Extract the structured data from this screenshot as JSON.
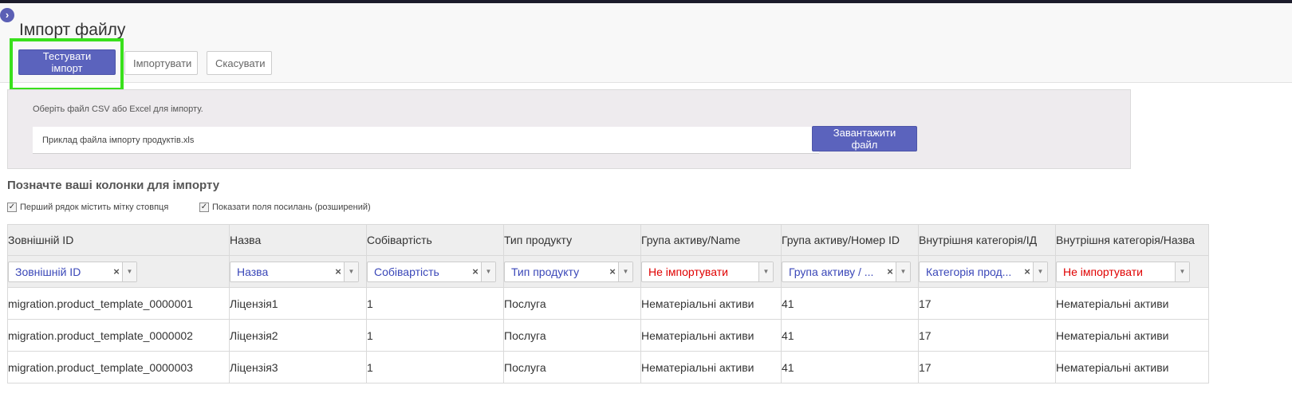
{
  "page": {
    "title": "Імпорт файлу",
    "buttons": {
      "test_import": "Тестувати імпорт",
      "import": "Імпортувати",
      "cancel": "Скасувати"
    }
  },
  "file": {
    "hint": "Оберіть файл CSV або Excel для імпорту.",
    "file_name": "Приклад файла імпорту продуктів.xls",
    "upload_label": "Завантажити файл"
  },
  "columns": {
    "title": "Позначте ваші колонки для імпорту",
    "option_headers": "Перший рядок містить мітку стовпця",
    "option_advanced": "Показати поля посилань (розширений)"
  },
  "table": {
    "headers": [
      "Зовнішній ID",
      "Назва",
      "Собівартість",
      "Тип продукту",
      "Група активу/Name",
      "Група активу/Номер ID",
      "Внутрішня категорія/ІД",
      "Внутрішня категорія/Назва"
    ],
    "mappings": [
      {
        "value": "Зовнішній ID",
        "clear": "×"
      },
      {
        "value": "Назва",
        "clear": "×"
      },
      {
        "value": "Собівартість",
        "clear": "×"
      },
      {
        "value": "Тип продукту",
        "clear": "×"
      },
      {
        "value": "Не імпортувати",
        "clear": ""
      },
      {
        "value": "Група активу / ...",
        "clear": "×"
      },
      {
        "value": "Категорія прод...",
        "clear": "×"
      },
      {
        "value": "Не імпортувати",
        "clear": ""
      }
    ],
    "rows": [
      [
        "migration.product_template_0000001",
        "Ліцензія1",
        "1",
        "Послуга",
        "Нематеріальні активи",
        "41",
        "17",
        "Нематеріальні активи"
      ],
      [
        "migration.product_template_0000002",
        "Ліцензія2",
        "1",
        "Послуга",
        "Нематеріальні активи",
        "41",
        "17",
        "Нематеріальні активи"
      ],
      [
        "migration.product_template_0000003",
        "Ліцензія3",
        "1",
        "Послуга",
        "Нематеріальні активи",
        "41",
        "17",
        "Нематеріальні активи"
      ]
    ]
  },
  "colors": {
    "primary": "#5b63bd",
    "highlight": "#39e01c",
    "mapped_text": "#3a47b8",
    "not_imported_text": "#e00000"
  },
  "icons": {
    "collapse": "chevron-right-icon",
    "clear": "clear-icon",
    "dropdown": "caret-down-icon",
    "checkbox": "checkbox-checked-icon"
  }
}
